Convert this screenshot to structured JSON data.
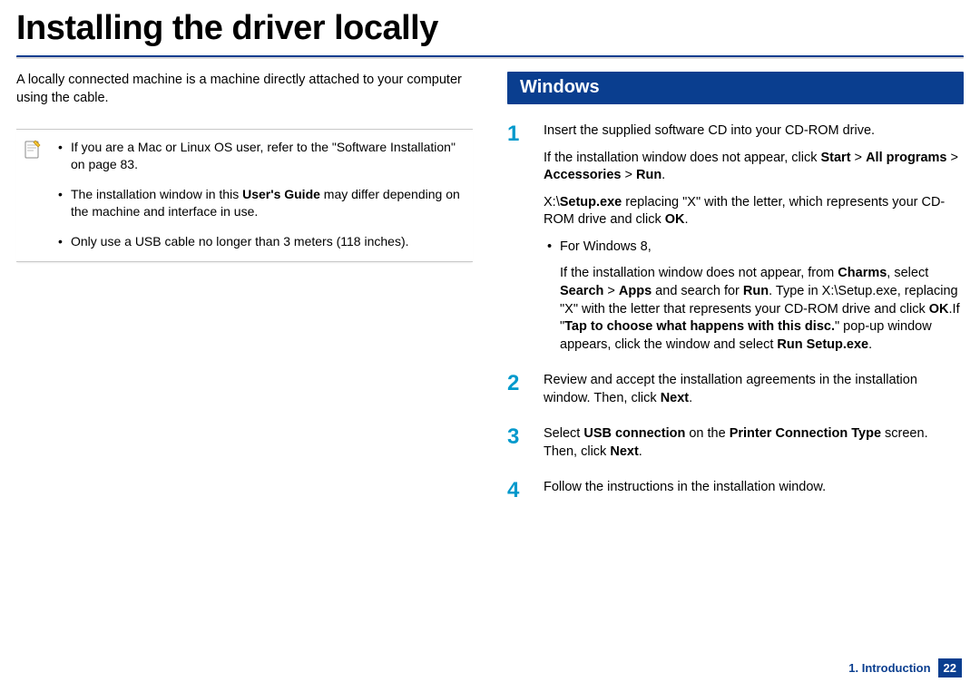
{
  "title": "Installing the driver locally",
  "intro": "A locally connected machine is a machine directly attached to your computer using the cable.",
  "notes": {
    "item1_pre": "If you are a Mac or Linux OS user, refer to the \"Software Installation\" on page 83.",
    "item2_pre": "The installation window in this ",
    "item2_bold": "User's Guide",
    "item2_post": " may differ depending on the machine and interface in use.",
    "item3": "Only use a USB cable no longer than 3 meters (118 inches)."
  },
  "section_heading": "Windows",
  "steps": {
    "s1": {
      "num": "1",
      "p1": "Insert the supplied software CD into your CD-ROM drive.",
      "p2_pre": "If the installation window does not appear, click ",
      "p2_b1": "Start",
      "p2_gt1": " > ",
      "p2_b2": "All programs",
      "p2_gt2": " > ",
      "p2_b3": "Accessories",
      "p2_gt3": " > ",
      "p2_b4": "Run",
      "p2_post": ".",
      "p3_pre": "X:\\",
      "p3_b1": "Setup.exe",
      "p3_mid": " replacing \"X\" with the letter, which represents your CD-ROM drive and click ",
      "p3_b2": "OK",
      "p3_post": ".",
      "bullet_label": "For Windows 8,",
      "bullet_body_pre": "If the installation window does not appear, from ",
      "bb_b1": "Charms",
      "bb_mid1": ", select ",
      "bb_b2": "Search",
      "bb_gt1": " > ",
      "bb_b3": "Apps",
      "bb_mid2": " and search for ",
      "bb_b4": "Run",
      "bb_mid3": ". Type in X:\\Setup.exe, replacing \"X\" with the letter that represents your CD-ROM drive and click ",
      "bb_b5": "OK",
      "bb_mid4": ".If \"",
      "bb_b6": "Tap to choose what happens with this disc.",
      "bb_mid5": "\" pop-up window appears, click the window and select ",
      "bb_b7": "Run Setup.exe",
      "bb_post": "."
    },
    "s2": {
      "num": "2",
      "pre": "Review and accept the installation agreements in the installation window. Then, click ",
      "b1": "Next",
      "post": "."
    },
    "s3": {
      "num": "3",
      "pre": "Select ",
      "b1": "USB connection",
      "mid1": " on the ",
      "b2": "Printer Connection Type",
      "mid2": " screen. Then, click ",
      "b3": "Next",
      "post": "."
    },
    "s4": {
      "num": "4",
      "text": "Follow the instructions in the installation window."
    }
  },
  "footer": {
    "chapter": "1. Introduction",
    "page": "22"
  }
}
